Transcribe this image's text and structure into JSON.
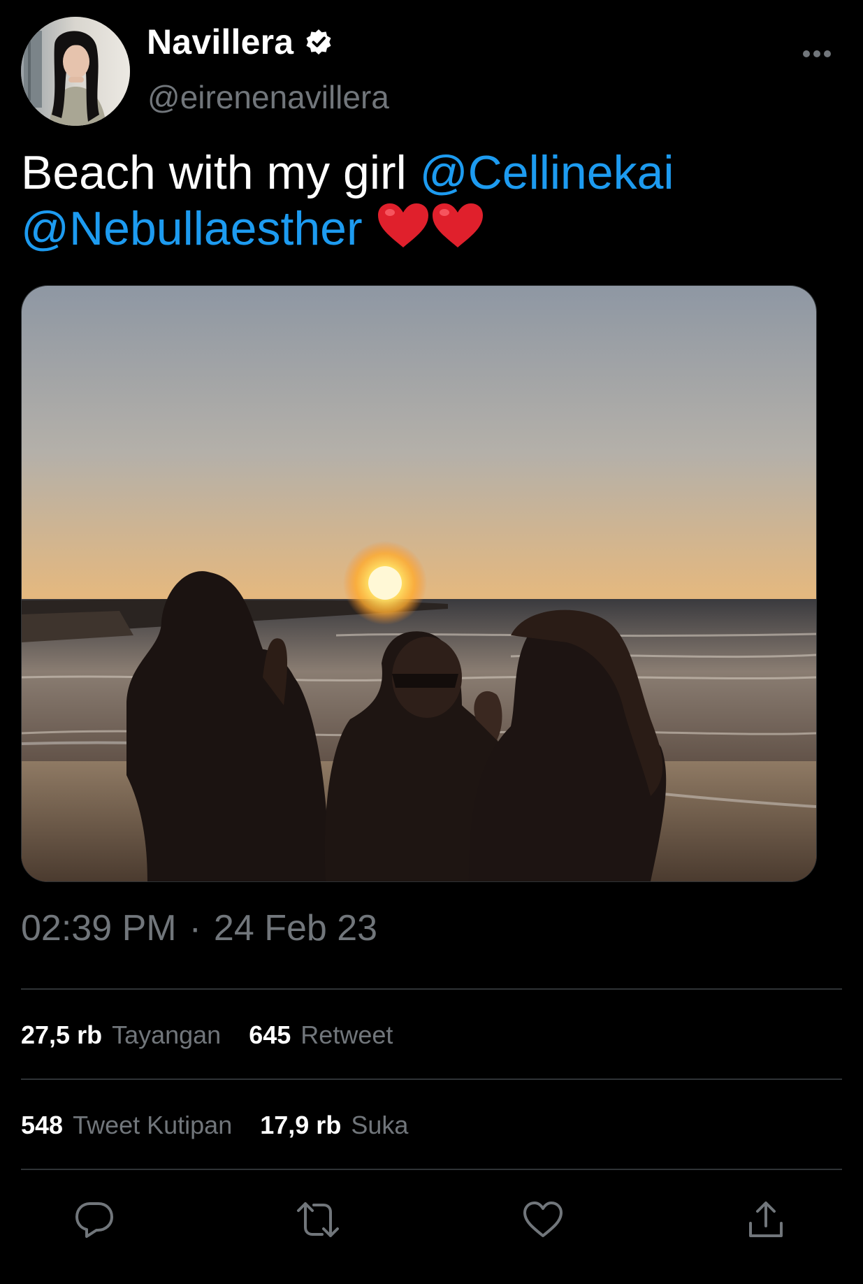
{
  "author": {
    "display_name": "Navillera",
    "handle": "@eirenenavillera",
    "verified_icon": "verified-badge-icon",
    "avatar": "profile-photo"
  },
  "tweet": {
    "text_prefix": "Beach with my girl",
    "mentions": [
      "@Cellinekai",
      "@Nebullaesther"
    ],
    "emoji": [
      "red-heart",
      "red-heart"
    ],
    "media": "photo-three-friends-on-beach-at-sunset"
  },
  "meta": {
    "time": "02:39 PM",
    "separator": "·",
    "date": "24 Feb 23"
  },
  "stats": {
    "views": {
      "count": "27,5 rb",
      "label": "Tayangan"
    },
    "retweets": {
      "count": "645",
      "label": "Retweet"
    },
    "quotes": {
      "count": "548",
      "label": "Tweet Kutipan"
    },
    "likes": {
      "count": "17,9 rb",
      "label": "Suka"
    }
  },
  "actions": [
    "reply-icon",
    "retweet-icon",
    "like-icon",
    "share-icon"
  ],
  "colors": {
    "background": "#000000",
    "text_primary": "#ffffff",
    "text_secondary": "#71767b",
    "link": "#1d9bf0",
    "divider": "#2f3336"
  }
}
